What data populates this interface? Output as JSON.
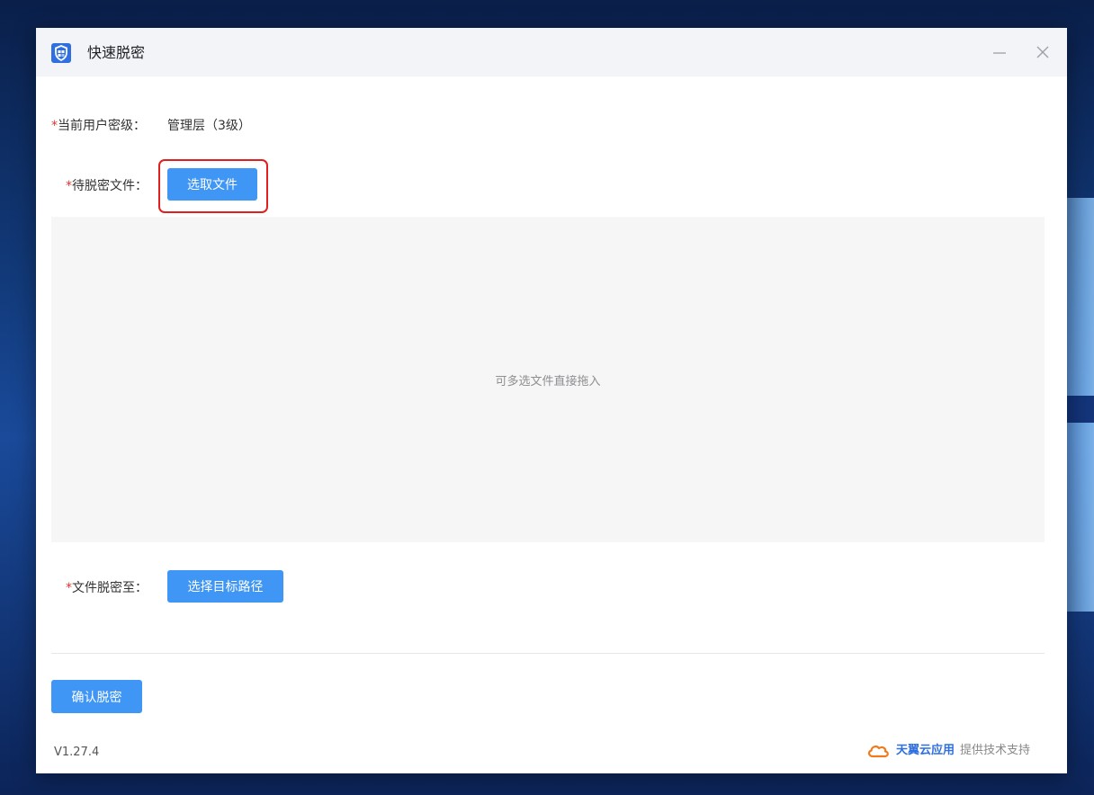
{
  "window": {
    "title": "快速脱密",
    "icons": {
      "logo": "shield-app-icon",
      "minimize": "minimize-icon",
      "close": "close-icon"
    }
  },
  "form": {
    "user_level": {
      "required_mark": "*",
      "label": "当前用户密级：",
      "value": "管理层（3级）"
    },
    "source_file": {
      "required_mark": "*",
      "label": "待脱密文件：",
      "button": "选取文件"
    },
    "dropzone": {
      "hint": "可多选文件直接拖入"
    },
    "target_path": {
      "required_mark": "*",
      "label": "文件脱密至：",
      "button": "选择目标路径"
    }
  },
  "actions": {
    "confirm": "确认脱密"
  },
  "footer": {
    "version": "V1.27.4",
    "brand_icon": "cloud-icon",
    "brand_name": "天翼云应用",
    "brand_suffix": "提供技术支持"
  },
  "colors": {
    "primary": "#3f96f4",
    "required": "#e5322d",
    "highlight": "#e02020",
    "brand": "#2f6fe0"
  }
}
